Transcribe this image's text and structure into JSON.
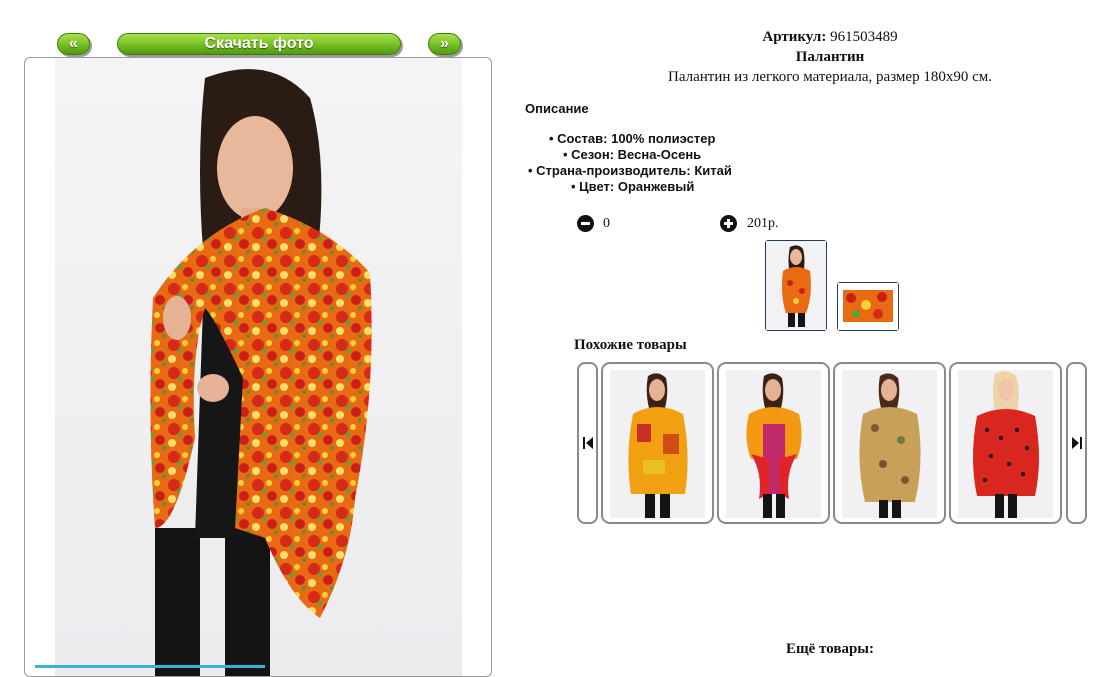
{
  "nav": {
    "prev_label": "«",
    "download_label": "Скачать фото",
    "next_label": "»"
  },
  "product": {
    "article_label": "Артикул:",
    "article_value": "961503489",
    "name": "Палантин",
    "short_description": "Палантин из легкого материала, размер 180х90 см."
  },
  "description": {
    "heading": "Описание",
    "items": [
      "Состав: 100% полиэстер",
      "Сезон: Весна-Осень",
      "Страна-производитель: Китай",
      "Цвет: Оранжевый"
    ]
  },
  "cart": {
    "quantity": "0",
    "price": "201р."
  },
  "similar": {
    "heading": "Похожие товары"
  },
  "more": {
    "heading": "Ещё товары:"
  },
  "colors": {
    "button_green": "#7fc42a",
    "border_dark": "#1f3f5e",
    "accent_cyan": "#37b5d8"
  },
  "icons": [
    "minus-circle-icon",
    "plus-circle-icon",
    "skip-previous-icon",
    "skip-next-icon"
  ]
}
